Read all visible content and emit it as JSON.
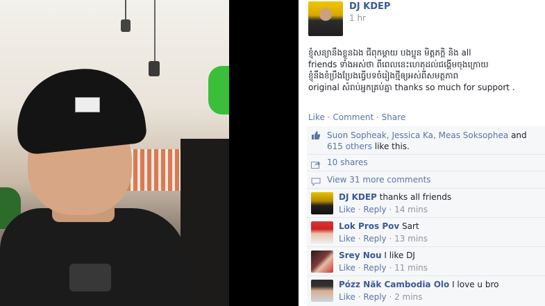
{
  "post": {
    "author": "DJ KDEP",
    "time": "1 hr",
    "body_line1": "ខ្ញុំសន្យានឹងខ្លួនឯង ជីពុកម្តាយ បងប្អូន មិត្តភក្តិ និង all",
    "body_line2": "friends ទាំងអស់ថា ពីពេលនេះហេតុដល់ជង្គើមចុងក្រោយ",
    "body_line3": "ខ្ញុំនឹងខំប្រឹងប្រែងធ្វើបទចំរៀងថ្មីឲ្យអស់ពីសមត្ថភាព",
    "body_line4": "original សំរាប់អ្នកគ្រប់គ្នា thanks so much for support ."
  },
  "actions": {
    "like": "Like",
    "sep1": " · ",
    "comment": "Comment",
    "sep2": " · ",
    "share": "Share"
  },
  "likes": {
    "names": "Suon Sopheak, Jessica Ka, Meas Soksophea",
    "and": " and",
    "others": "615 others",
    "tail": " like this."
  },
  "shares_label": "10 shares",
  "more_comments": "View 31 more comments",
  "comments": [
    {
      "author": "DJ KDEP",
      "text": " thanks all friends",
      "like": "Like",
      "reply": "Reply",
      "time": "14 mins"
    },
    {
      "author": "Lok Pros Pov",
      "text": " Sart",
      "like": "Like",
      "reply": "Reply",
      "time": "13 mins"
    },
    {
      "author": "Srey Nou",
      "text": " I like DJ",
      "like": "Like",
      "reply": "Reply",
      "time": "11 mins"
    },
    {
      "author": "Pózz Näk Cambodia Olo",
      "text": " I love u bro",
      "like": "Like",
      "reply": "Reply",
      "time": "2 mins"
    }
  ],
  "dot": " · ",
  "colors": {
    "link": "#3b5998",
    "gray": "#90949c",
    "panel": "#f6f7f9"
  },
  "icons": [
    "thumbs-up-icon",
    "share-icon",
    "comment-icon"
  ]
}
